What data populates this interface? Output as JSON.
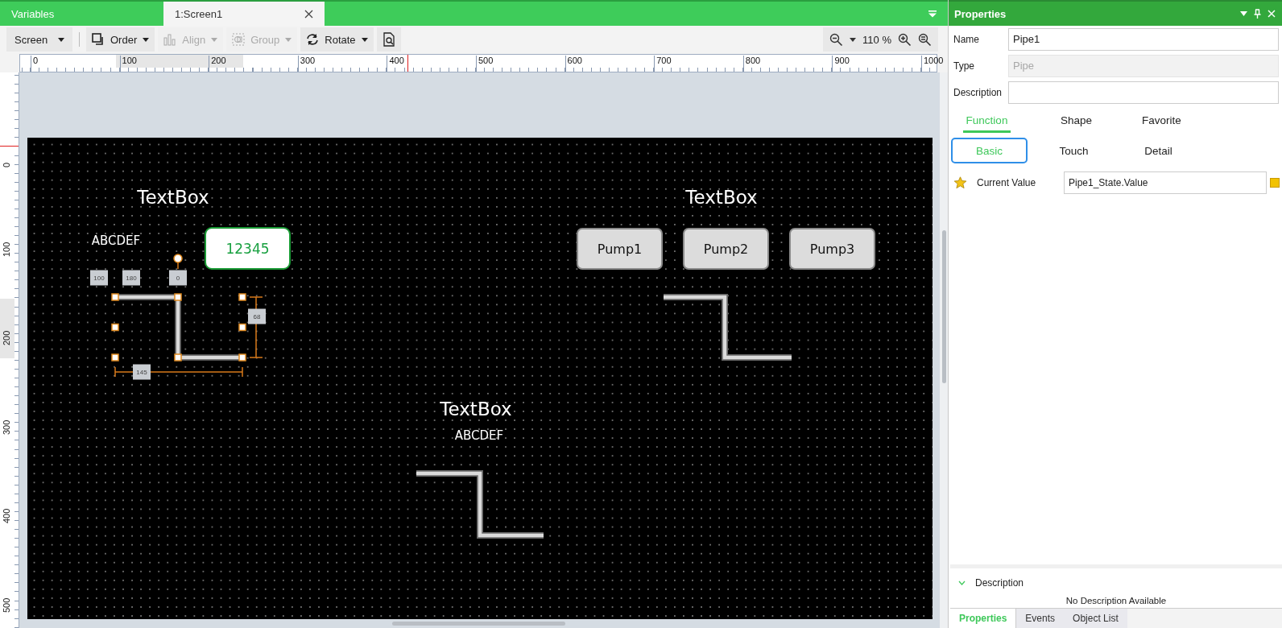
{
  "document_tabs": [
    {
      "label": "Variables",
      "selected": false
    },
    {
      "label": "1:Screen1",
      "selected": true
    }
  ],
  "toolbar": {
    "items": [
      {
        "kind": "dropdown",
        "label": "Screen",
        "disabled": false
      },
      {
        "kind": "order",
        "label": "Order",
        "disabled": false
      },
      {
        "kind": "align",
        "label": "Align",
        "disabled": true
      },
      {
        "kind": "group",
        "label": "Group",
        "disabled": true
      },
      {
        "kind": "rotate",
        "label": "Rotate",
        "disabled": false
      },
      {
        "kind": "preview",
        "disabled": false
      }
    ],
    "zoom": "110 %"
  },
  "rulers": {
    "horizontal": [
      "0",
      "100",
      "200",
      "300",
      "400",
      "500",
      "600",
      "700",
      "800",
      "900",
      "1000"
    ],
    "vertical": [
      "0",
      "100",
      "200",
      "300",
      "400",
      "500"
    ]
  },
  "canvas": {
    "objects": [
      {
        "kind": "heading",
        "text": "TextBox"
      },
      {
        "kind": "heading",
        "text": "TextBox"
      },
      {
        "kind": "text",
        "text": "ABCDEF"
      },
      {
        "kind": "numeric-display",
        "text": "12345"
      },
      {
        "kind": "button",
        "text": "Pump1"
      },
      {
        "kind": "button",
        "text": "Pump2"
      },
      {
        "kind": "button",
        "text": "Pump3"
      },
      {
        "kind": "pipe",
        "selected": true
      },
      {
        "kind": "pipe",
        "selected": false
      },
      {
        "kind": "heading",
        "text": "TextBox"
      },
      {
        "kind": "text",
        "text": "ABCDEF"
      },
      {
        "kind": "pipe",
        "selected": false
      }
    ],
    "selection_tags": [
      "100",
      "180",
      "0",
      "68",
      "145"
    ]
  },
  "properties_panel": {
    "title": "Properties",
    "fields": [
      {
        "label": "Name",
        "value": "Pipe1",
        "disabled": false
      },
      {
        "label": "Type",
        "value": "Pipe",
        "disabled": true
      },
      {
        "label": "Description",
        "disabled": false
      }
    ],
    "tabs": [
      {
        "label": "Function",
        "selected": true
      },
      {
        "label": "Shape",
        "selected": false
      },
      {
        "label": "Favorite",
        "selected": false
      }
    ],
    "subtabs": [
      {
        "label": "Basic",
        "selected": true
      },
      {
        "label": "Touch",
        "selected": false
      },
      {
        "label": "Detail",
        "selected": false
      }
    ],
    "properties": [
      {
        "label": "Current Value",
        "value": "Pipe1_State.Value",
        "favorite": true
      }
    ],
    "description_section": {
      "title": "Description",
      "expanded": true,
      "text": "No Description Available"
    },
    "bottom_tabs": [
      {
        "label": "Properties",
        "selected": true
      },
      {
        "label": "Events",
        "selected": false
      },
      {
        "label": "Object List",
        "selected": false
      }
    ]
  }
}
